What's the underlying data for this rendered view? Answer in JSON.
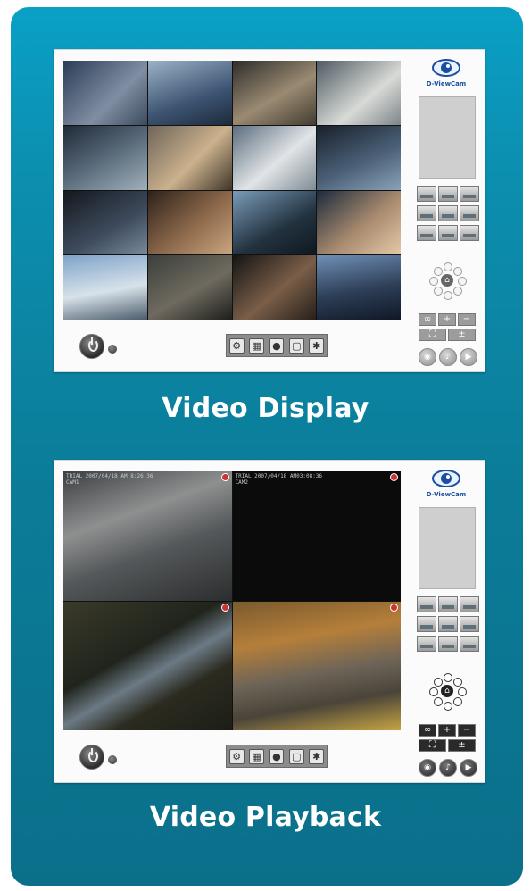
{
  "brand": "D-ViewCam",
  "section1": {
    "caption": "Video Display"
  },
  "section2": {
    "caption": "Video Playback",
    "cameras": [
      {
        "overlay": "TRIAL 2007/04/18 AM 8:26:36",
        "cam": "CAM1"
      },
      {
        "overlay": "TRIAL 2007/04/18 AM03:08:36",
        "cam": "CAM2"
      },
      {
        "overlay": "",
        "cam": ""
      },
      {
        "overlay": "",
        "cam": ""
      }
    ]
  },
  "tools": [
    "settings-a",
    "settings-b",
    "record",
    "page",
    "gear"
  ],
  "zoom": {
    "plus": "+",
    "minus": "−",
    "tilde": "±"
  },
  "colors": {
    "card_top": "#0aa0c6",
    "card_bottom": "#0b6f8a",
    "panel_bg": "#fbfbfb"
  }
}
